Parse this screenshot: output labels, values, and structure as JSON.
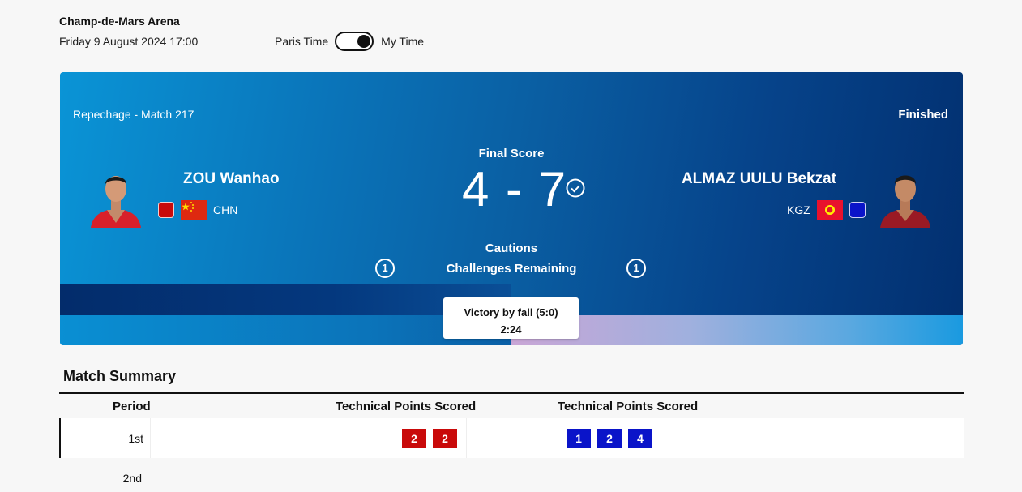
{
  "venue": "Champ-de-Mars Arena",
  "datetime": "Friday 9 August 2024 17:00",
  "time_toggle": {
    "left_label": "Paris Time",
    "right_label": "My Time",
    "selected": "My Time"
  },
  "match": {
    "round": "Repechage - Match 217",
    "status": "Finished",
    "final_label": "Final Score",
    "score": "4 - 7",
    "cautions_label": "Cautions",
    "challenges_label": "Challenges Remaining",
    "left": {
      "name": "ZOU Wanhao",
      "country": "CHN",
      "color": "#c90a0a",
      "challenges": "1"
    },
    "right": {
      "name": "ALMAZ UULU Bekzat",
      "country": "KGZ",
      "color": "#0a14c9",
      "challenges": "1"
    },
    "victory_type": "Victory by fall (5:0)",
    "victory_time": "2:24"
  },
  "summary": {
    "title": "Match Summary",
    "headers": {
      "period": "Period",
      "left_points": "Technical Points Scored",
      "right_points": "Technical Points Scored"
    },
    "rows": [
      {
        "period": "1st",
        "left": [
          "2",
          "2"
        ],
        "right": [
          "1",
          "2",
          "4"
        ]
      },
      {
        "period": "2nd",
        "left": [],
        "right": []
      }
    ]
  }
}
